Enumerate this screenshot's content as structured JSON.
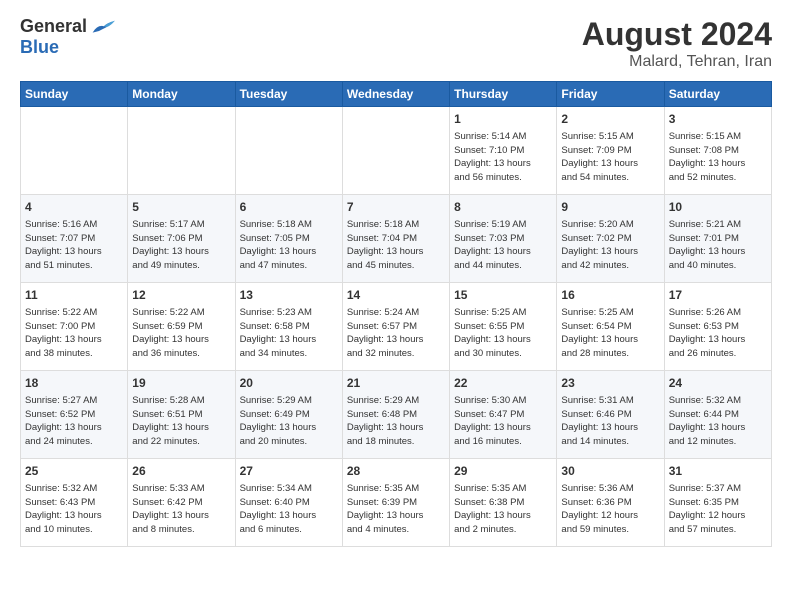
{
  "logo": {
    "general": "General",
    "blue": "Blue"
  },
  "title": "August 2024",
  "subtitle": "Malard, Tehran, Iran",
  "weekdays": [
    "Sunday",
    "Monday",
    "Tuesday",
    "Wednesday",
    "Thursday",
    "Friday",
    "Saturday"
  ],
  "weeks": [
    [
      {
        "day": "",
        "info": ""
      },
      {
        "day": "",
        "info": ""
      },
      {
        "day": "",
        "info": ""
      },
      {
        "day": "",
        "info": ""
      },
      {
        "day": "1",
        "info": "Sunrise: 5:14 AM\nSunset: 7:10 PM\nDaylight: 13 hours\nand 56 minutes."
      },
      {
        "day": "2",
        "info": "Sunrise: 5:15 AM\nSunset: 7:09 PM\nDaylight: 13 hours\nand 54 minutes."
      },
      {
        "day": "3",
        "info": "Sunrise: 5:15 AM\nSunset: 7:08 PM\nDaylight: 13 hours\nand 52 minutes."
      }
    ],
    [
      {
        "day": "4",
        "info": "Sunrise: 5:16 AM\nSunset: 7:07 PM\nDaylight: 13 hours\nand 51 minutes."
      },
      {
        "day": "5",
        "info": "Sunrise: 5:17 AM\nSunset: 7:06 PM\nDaylight: 13 hours\nand 49 minutes."
      },
      {
        "day": "6",
        "info": "Sunrise: 5:18 AM\nSunset: 7:05 PM\nDaylight: 13 hours\nand 47 minutes."
      },
      {
        "day": "7",
        "info": "Sunrise: 5:18 AM\nSunset: 7:04 PM\nDaylight: 13 hours\nand 45 minutes."
      },
      {
        "day": "8",
        "info": "Sunrise: 5:19 AM\nSunset: 7:03 PM\nDaylight: 13 hours\nand 44 minutes."
      },
      {
        "day": "9",
        "info": "Sunrise: 5:20 AM\nSunset: 7:02 PM\nDaylight: 13 hours\nand 42 minutes."
      },
      {
        "day": "10",
        "info": "Sunrise: 5:21 AM\nSunset: 7:01 PM\nDaylight: 13 hours\nand 40 minutes."
      }
    ],
    [
      {
        "day": "11",
        "info": "Sunrise: 5:22 AM\nSunset: 7:00 PM\nDaylight: 13 hours\nand 38 minutes."
      },
      {
        "day": "12",
        "info": "Sunrise: 5:22 AM\nSunset: 6:59 PM\nDaylight: 13 hours\nand 36 minutes."
      },
      {
        "day": "13",
        "info": "Sunrise: 5:23 AM\nSunset: 6:58 PM\nDaylight: 13 hours\nand 34 minutes."
      },
      {
        "day": "14",
        "info": "Sunrise: 5:24 AM\nSunset: 6:57 PM\nDaylight: 13 hours\nand 32 minutes."
      },
      {
        "day": "15",
        "info": "Sunrise: 5:25 AM\nSunset: 6:55 PM\nDaylight: 13 hours\nand 30 minutes."
      },
      {
        "day": "16",
        "info": "Sunrise: 5:25 AM\nSunset: 6:54 PM\nDaylight: 13 hours\nand 28 minutes."
      },
      {
        "day": "17",
        "info": "Sunrise: 5:26 AM\nSunset: 6:53 PM\nDaylight: 13 hours\nand 26 minutes."
      }
    ],
    [
      {
        "day": "18",
        "info": "Sunrise: 5:27 AM\nSunset: 6:52 PM\nDaylight: 13 hours\nand 24 minutes."
      },
      {
        "day": "19",
        "info": "Sunrise: 5:28 AM\nSunset: 6:51 PM\nDaylight: 13 hours\nand 22 minutes."
      },
      {
        "day": "20",
        "info": "Sunrise: 5:29 AM\nSunset: 6:49 PM\nDaylight: 13 hours\nand 20 minutes."
      },
      {
        "day": "21",
        "info": "Sunrise: 5:29 AM\nSunset: 6:48 PM\nDaylight: 13 hours\nand 18 minutes."
      },
      {
        "day": "22",
        "info": "Sunrise: 5:30 AM\nSunset: 6:47 PM\nDaylight: 13 hours\nand 16 minutes."
      },
      {
        "day": "23",
        "info": "Sunrise: 5:31 AM\nSunset: 6:46 PM\nDaylight: 13 hours\nand 14 minutes."
      },
      {
        "day": "24",
        "info": "Sunrise: 5:32 AM\nSunset: 6:44 PM\nDaylight: 13 hours\nand 12 minutes."
      }
    ],
    [
      {
        "day": "25",
        "info": "Sunrise: 5:32 AM\nSunset: 6:43 PM\nDaylight: 13 hours\nand 10 minutes."
      },
      {
        "day": "26",
        "info": "Sunrise: 5:33 AM\nSunset: 6:42 PM\nDaylight: 13 hours\nand 8 minutes."
      },
      {
        "day": "27",
        "info": "Sunrise: 5:34 AM\nSunset: 6:40 PM\nDaylight: 13 hours\nand 6 minutes."
      },
      {
        "day": "28",
        "info": "Sunrise: 5:35 AM\nSunset: 6:39 PM\nDaylight: 13 hours\nand 4 minutes."
      },
      {
        "day": "29",
        "info": "Sunrise: 5:35 AM\nSunset: 6:38 PM\nDaylight: 13 hours\nand 2 minutes."
      },
      {
        "day": "30",
        "info": "Sunrise: 5:36 AM\nSunset: 6:36 PM\nDaylight: 12 hours\nand 59 minutes."
      },
      {
        "day": "31",
        "info": "Sunrise: 5:37 AM\nSunset: 6:35 PM\nDaylight: 12 hours\nand 57 minutes."
      }
    ]
  ]
}
